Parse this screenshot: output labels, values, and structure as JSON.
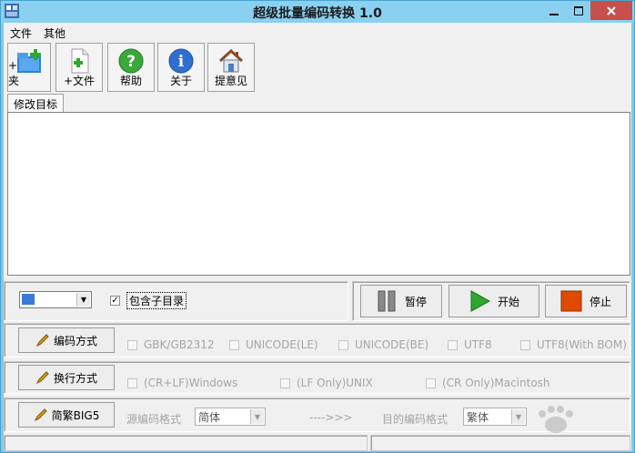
{
  "window": {
    "title": "超级批量编码转换 1.0"
  },
  "menu": [
    {
      "label": "文件"
    },
    {
      "label": "其他"
    }
  ],
  "toolbar": [
    {
      "label": "+文件夹",
      "icon": "folder-add-icon"
    },
    {
      "label": "+文件",
      "icon": "file-add-icon"
    },
    {
      "label": "帮助",
      "icon": "help-icon"
    },
    {
      "label": "关于",
      "icon": "info-icon"
    },
    {
      "label": "提意见",
      "icon": "home-icon"
    }
  ],
  "tab": {
    "label": "修改目标"
  },
  "options": {
    "include_subdirs_label": "包含子目录",
    "include_subdirs_checked": true,
    "check_glyph": "✓"
  },
  "actions": {
    "pause_label": "暂停",
    "start_label": "开始",
    "stop_label": "停止"
  },
  "encoding": {
    "button_label": "编码方式",
    "options": [
      "GBK/GB2312",
      "UNICODE(LE)",
      "UNICODE(BE)",
      "UTF8",
      "UTF8(With BOM)"
    ]
  },
  "linebreak": {
    "button_label": "换行方式",
    "options": [
      "(CR+LF)Windows",
      "(LF Only)UNIX",
      "(CR Only)Macintosh"
    ]
  },
  "convert": {
    "button_label": "简繁BIG5",
    "source_label": "源编码格式",
    "source_value": "简体",
    "arrow_text": "---->>>",
    "target_label": "目的编码格式",
    "target_value": "繁体"
  },
  "colors": {
    "titlebar": "#8ad0f0",
    "close": "#c7504b",
    "start_green": "#2fa82f",
    "stop_red": "#e04a00"
  }
}
